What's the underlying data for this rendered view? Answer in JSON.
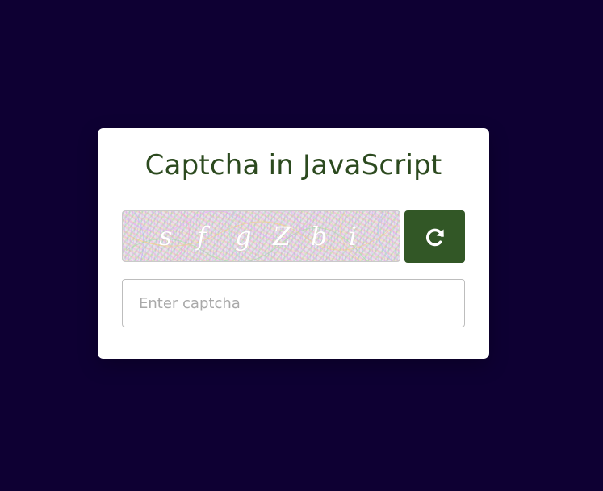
{
  "card": {
    "title": "Captcha in JavaScript"
  },
  "captcha": {
    "characters": [
      "s",
      "f",
      "g",
      "Z",
      "b",
      "i"
    ],
    "refresh_icon": "refresh-icon"
  },
  "input": {
    "value": "",
    "placeholder": "Enter captcha"
  },
  "colors": {
    "background": "#0e0033",
    "card": "#ffffff",
    "title": "#2c4a1f",
    "refresh_button": "#325726"
  }
}
